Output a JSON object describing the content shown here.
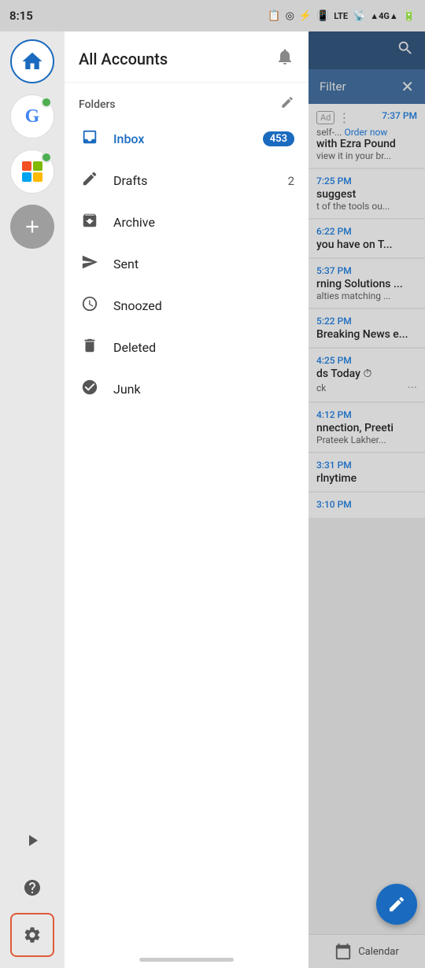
{
  "statusBar": {
    "time": "8:15",
    "icons": [
      "📋",
      "◎",
      "🔵",
      "📶",
      "LTE",
      "📡",
      "▲4G▲",
      "🔋"
    ]
  },
  "sidebar": {
    "avatars": [
      {
        "id": "home",
        "type": "home",
        "active": true
      },
      {
        "id": "google",
        "type": "google",
        "hasBadge": true
      },
      {
        "id": "office",
        "type": "office",
        "hasBadge": true
      },
      {
        "id": "add",
        "type": "add"
      }
    ],
    "bottomIcons": [
      {
        "id": "play",
        "label": "play-icon",
        "symbol": "▶"
      },
      {
        "id": "help",
        "label": "help-icon",
        "symbol": "?"
      },
      {
        "id": "settings",
        "label": "settings-icon",
        "symbol": "⚙",
        "active": true
      }
    ]
  },
  "drawer": {
    "title": "All Accounts",
    "bellLabel": "notifications-bell",
    "foldersLabel": "Folders",
    "editLabel": "edit-folders",
    "items": [
      {
        "id": "inbox",
        "label": "Inbox",
        "icon": "inbox",
        "badge": "453",
        "active": true
      },
      {
        "id": "drafts",
        "label": "Drafts",
        "icon": "drafts",
        "count": "2"
      },
      {
        "id": "archive",
        "label": "Archive",
        "icon": "archive",
        "count": ""
      },
      {
        "id": "sent",
        "label": "Sent",
        "icon": "sent",
        "count": ""
      },
      {
        "id": "snoozed",
        "label": "Snoozed",
        "icon": "snoozed",
        "count": ""
      },
      {
        "id": "deleted",
        "label": "Deleted",
        "icon": "deleted",
        "count": ""
      },
      {
        "id": "junk",
        "label": "Junk",
        "icon": "junk",
        "count": ""
      }
    ]
  },
  "emailPanel": {
    "searchLabel": "search",
    "filterLabel": "Filter",
    "emails": [
      {
        "id": 1,
        "time": "7:37 PM",
        "sender": "with Ezra Pound",
        "preview": "view it in your br...",
        "isAd": true
      },
      {
        "id": 2,
        "time": "7:25 PM",
        "sender": "suggest",
        "preview": "t of the tools ou..."
      },
      {
        "id": 3,
        "time": "6:22 PM",
        "sender": "you have on T...",
        "preview": ""
      },
      {
        "id": 4,
        "time": "5:37 PM",
        "sender": "rning Solutions ...",
        "preview": "alties matching ..."
      },
      {
        "id": 5,
        "time": "5:22 PM",
        "sender": "Breaking News e...",
        "preview": ""
      },
      {
        "id": 6,
        "time": "4:25 PM",
        "sender": "ds Today ⏱",
        "preview": "ck",
        "hasEllipsis": true
      },
      {
        "id": 7,
        "time": "4:12 PM",
        "sender": "nnection, Preeti",
        "preview": "Prateek Lakher..."
      },
      {
        "id": 8,
        "time": "3:31 PM",
        "sender": "rlnytime",
        "preview": ""
      },
      {
        "id": 9,
        "time": "3:10 PM",
        "sender": "",
        "preview": ""
      }
    ],
    "fab": {
      "label": "compose-button",
      "symbol": "✏"
    },
    "calendarLabel": "Calendar"
  }
}
